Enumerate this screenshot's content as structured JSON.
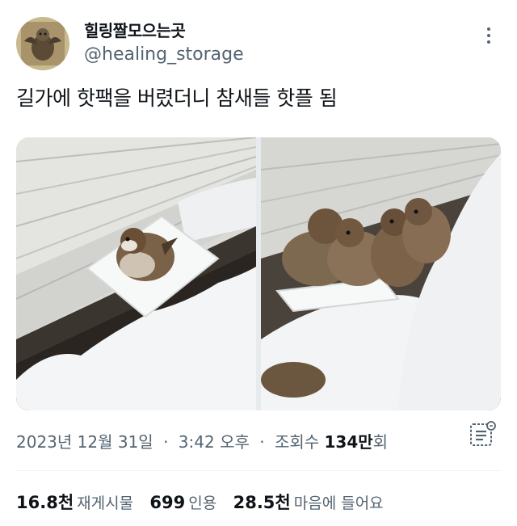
{
  "author": {
    "display_name": "힐링짤모으는곳",
    "handle": "@healing_storage"
  },
  "tweet": {
    "text": "길가에 핫팩을 버렸더니 참새들 핫플 됨"
  },
  "meta": {
    "date": "2023년 12월 31일",
    "time": "3:42 오후",
    "views_label": "조회수",
    "views_count": "134만",
    "views_unit": "회",
    "separator": "·"
  },
  "stats": {
    "retweets_count": "16.8천",
    "retweets_label": "재게시물",
    "quotes_count": "699",
    "quotes_label": "인용",
    "likes_count": "28.5천",
    "likes_label": "마음에 들어요"
  },
  "icons": {
    "more": "more-vertical-icon",
    "analytics": "analytics-icon"
  },
  "colors": {
    "text": "#0f1419",
    "secondary": "#536471",
    "divider": "#eff3f4"
  }
}
